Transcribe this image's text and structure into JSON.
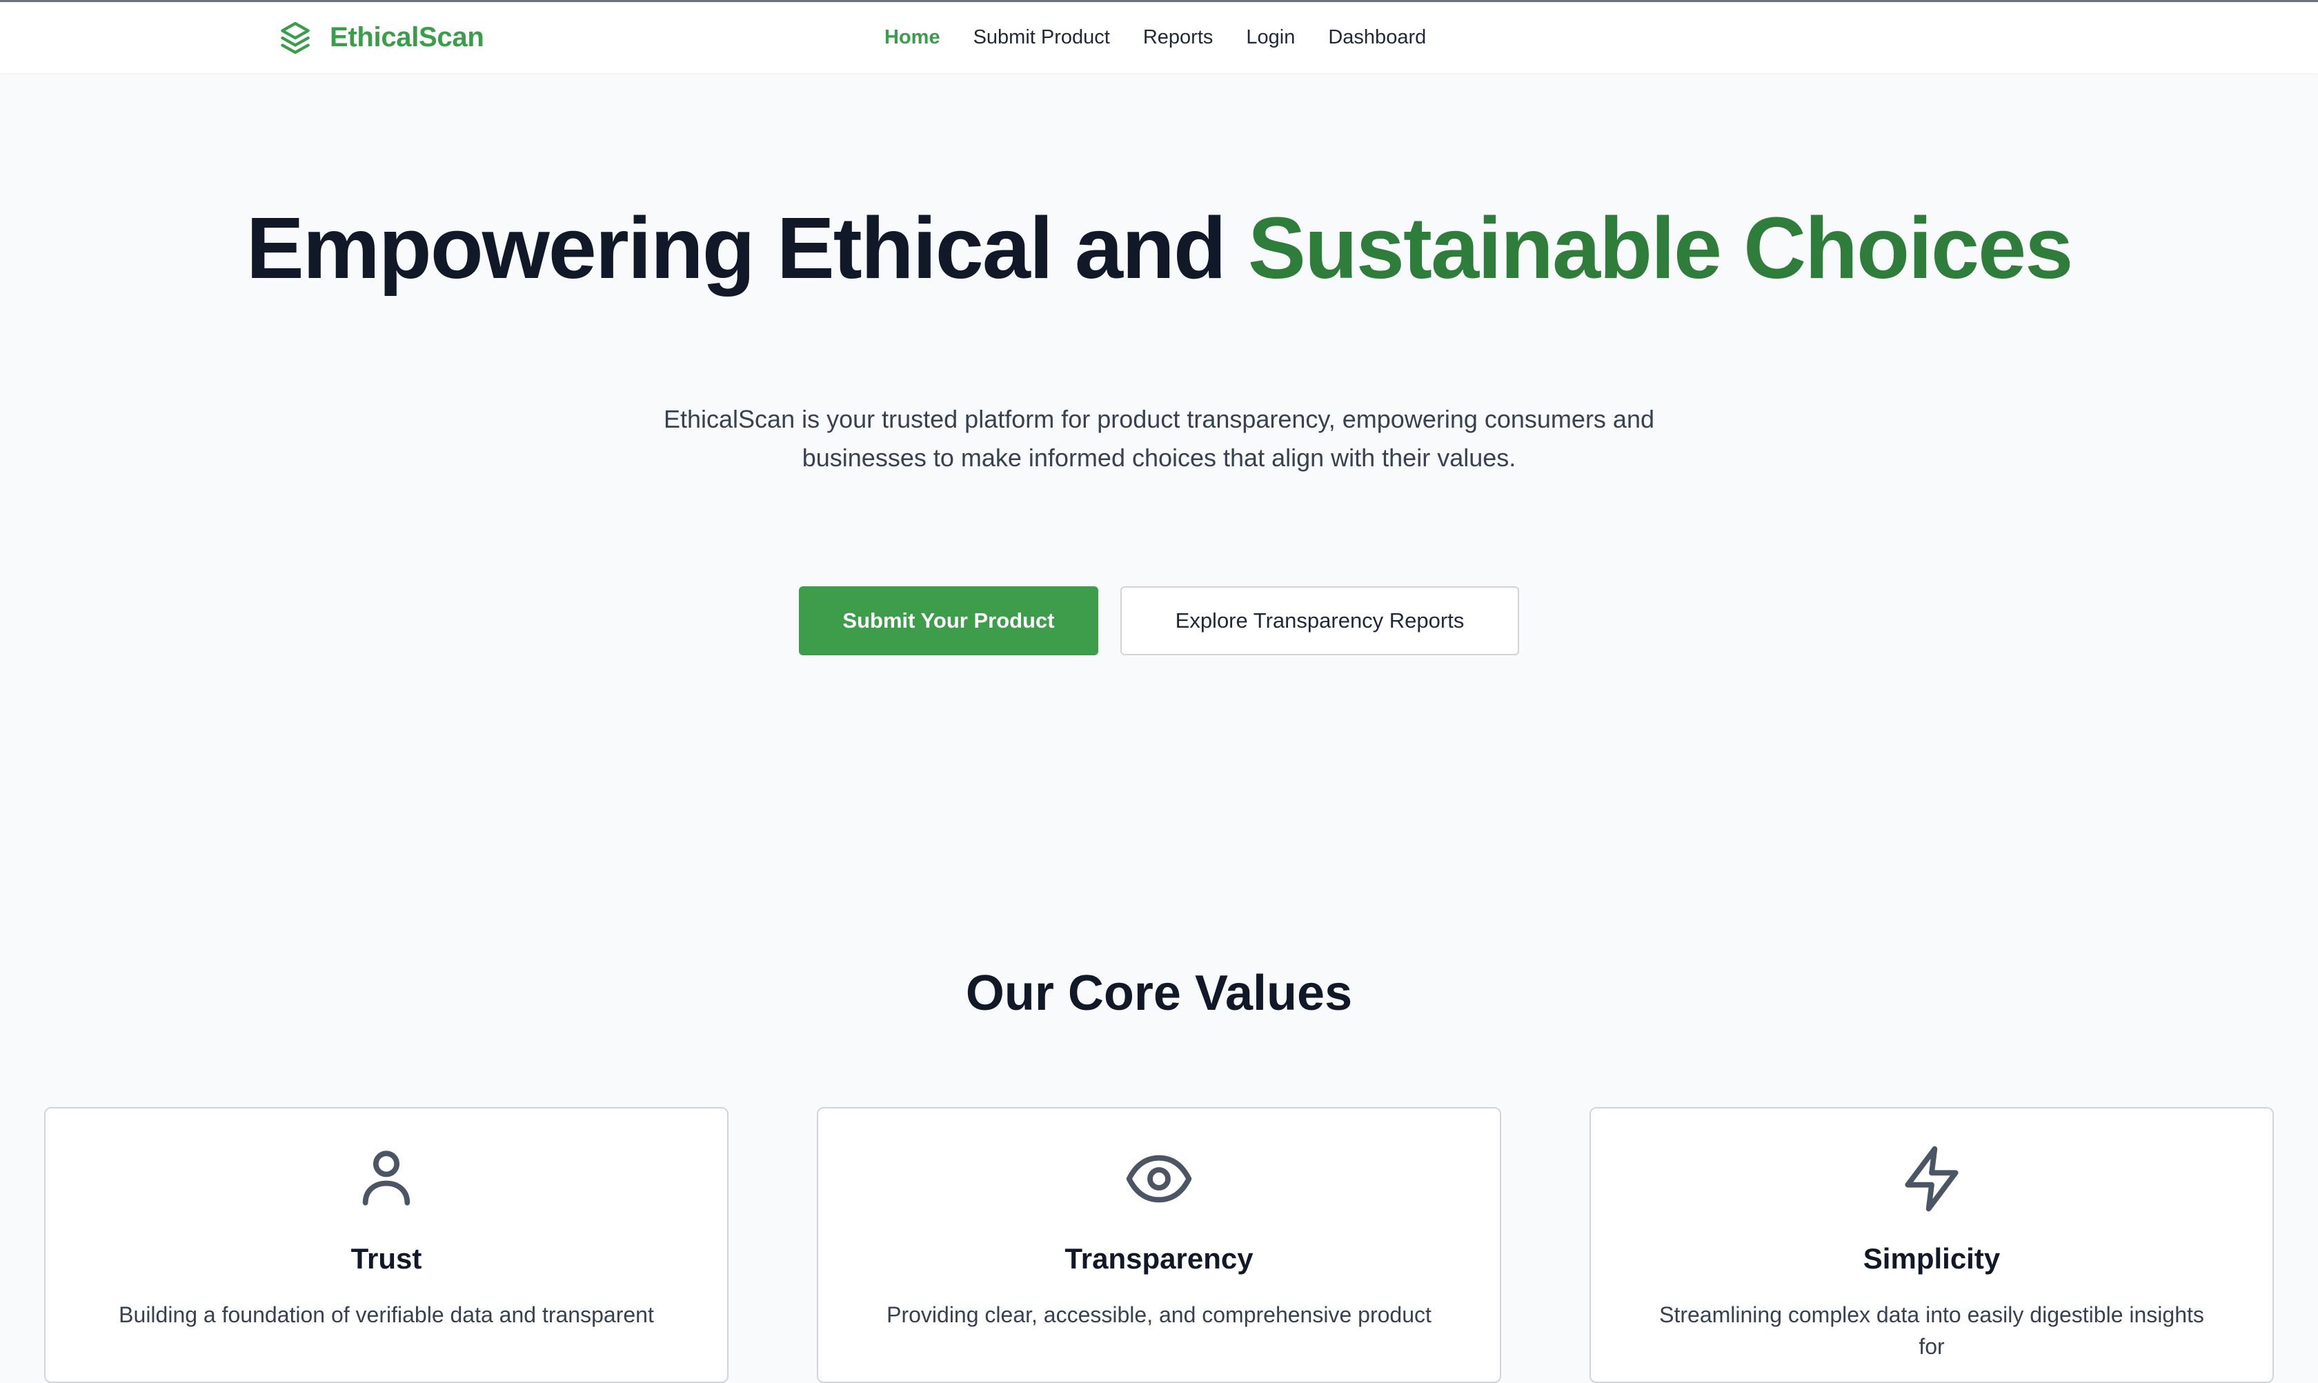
{
  "brand": {
    "name": "EthicalScan",
    "icon": "layers-icon",
    "color": "#3a9d49"
  },
  "nav": {
    "items": [
      {
        "label": "Home",
        "active": true
      },
      {
        "label": "Submit Product",
        "active": false
      },
      {
        "label": "Reports",
        "active": false
      },
      {
        "label": "Login",
        "active": false
      },
      {
        "label": "Dashboard",
        "active": false
      }
    ]
  },
  "hero": {
    "title_main": "Empowering Ethical and ",
    "title_accent": "Sustainable Choices",
    "subtitle": "EthicalScan is your trusted platform for product transparency, empowering consumers and businesses to make informed choices that align with their values.",
    "primary_button": "Submit Your Product",
    "secondary_button": "Explore Transparency Reports"
  },
  "values": {
    "heading": "Our Core Values",
    "cards": [
      {
        "icon": "user-icon",
        "title": "Trust",
        "description": "Building a foundation of verifiable data and transparent"
      },
      {
        "icon": "eye-icon",
        "title": "Transparency",
        "description": "Providing clear, accessible, and comprehensive product"
      },
      {
        "icon": "lightning-icon",
        "title": "Simplicity",
        "description": "Streamlining complex data into easily digestible insights for"
      }
    ]
  },
  "colors": {
    "accent": "#3a9d49",
    "accent_dark": "#2f7d3a",
    "background": "#f8fafc"
  }
}
